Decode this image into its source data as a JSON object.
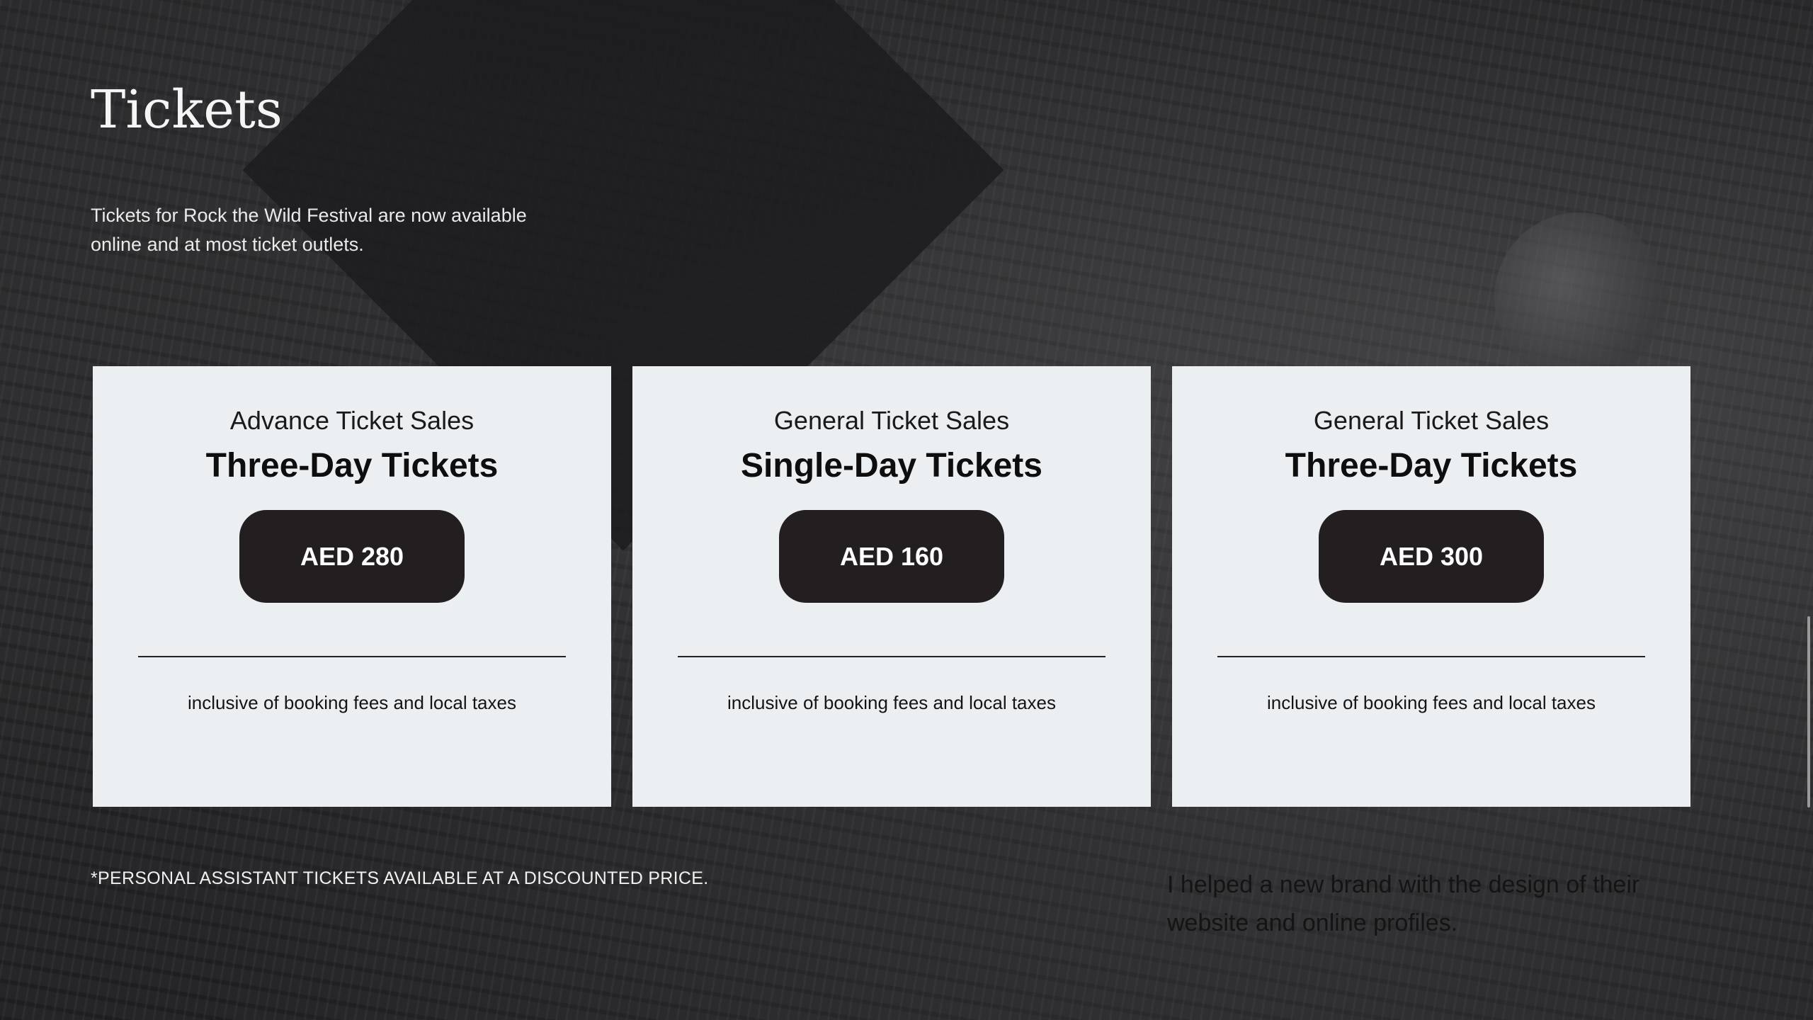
{
  "section": {
    "title": "Tickets",
    "intro": "Tickets for Rock the Wild Festival are now available online and at most ticket outlets."
  },
  "cards": [
    {
      "subtitle": "Advance Ticket Sales",
      "title": "Three-Day Tickets",
      "price": "AED 280",
      "note": "inclusive of booking fees and local taxes"
    },
    {
      "subtitle": "General Ticket Sales",
      "title": "Single-Day Tickets",
      "price": "AED 160",
      "note": "inclusive of booking fees and local taxes"
    },
    {
      "subtitle": "General Ticket Sales",
      "title": "Three-Day Tickets",
      "price": "AED 300",
      "note": "inclusive of booking fees and local taxes"
    }
  ],
  "footnote": "*PERSONAL ASSISTANT TICKETS AVAILABLE AT A DISCOUNTED PRICE.",
  "side_text": "I helped a new brand with the design of their website and online profiles.",
  "colors": {
    "background": "#1d1d1f",
    "card_background": "#eceff2",
    "price_button": "#231f20"
  }
}
